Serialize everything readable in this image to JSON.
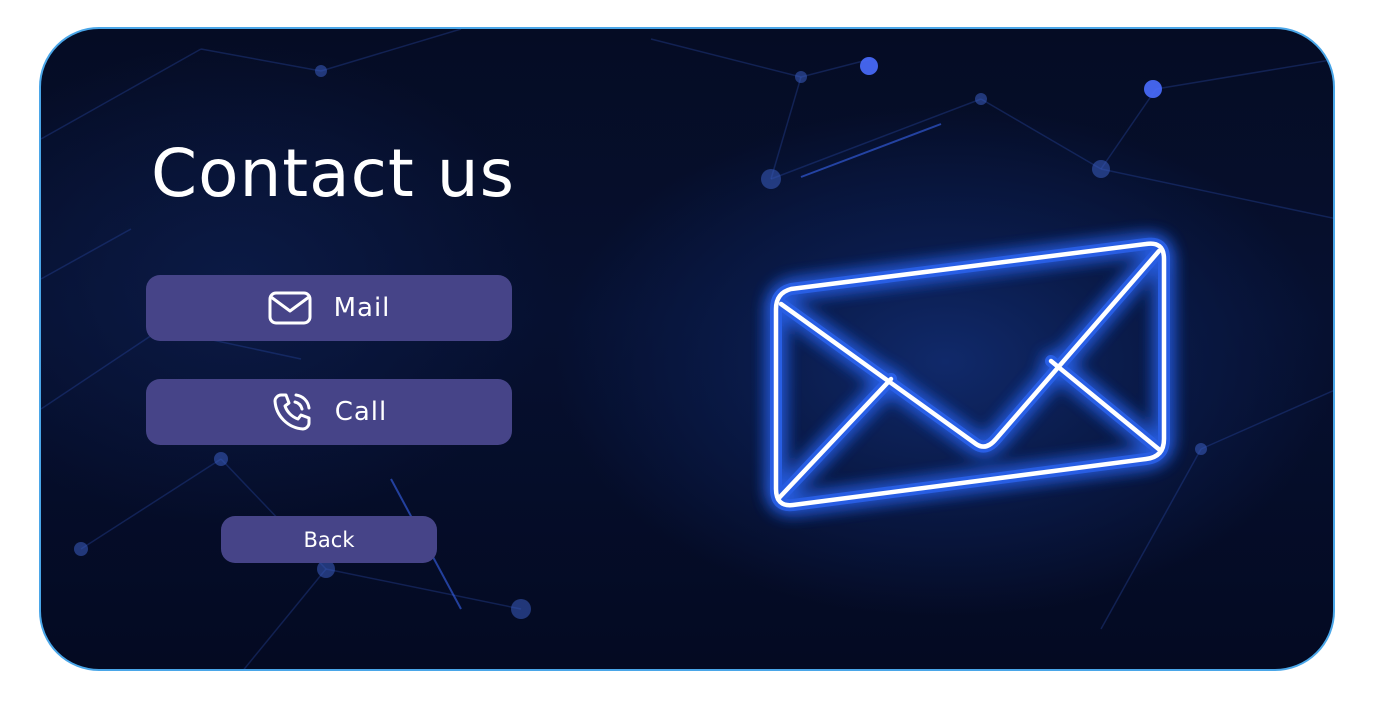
{
  "page": {
    "title": "Contact us"
  },
  "buttons": {
    "mail_label": "Mail",
    "call_label": "Call",
    "back_label": "Back"
  },
  "icons": {
    "mail": "mail-icon",
    "call": "phone-call-icon",
    "hero": "envelope-icon"
  },
  "colors": {
    "button_bg": "#464488",
    "card_border": "#4aa6e8",
    "background": "#061030",
    "neon_glow": "#2f6bff",
    "text": "#ffffff"
  }
}
